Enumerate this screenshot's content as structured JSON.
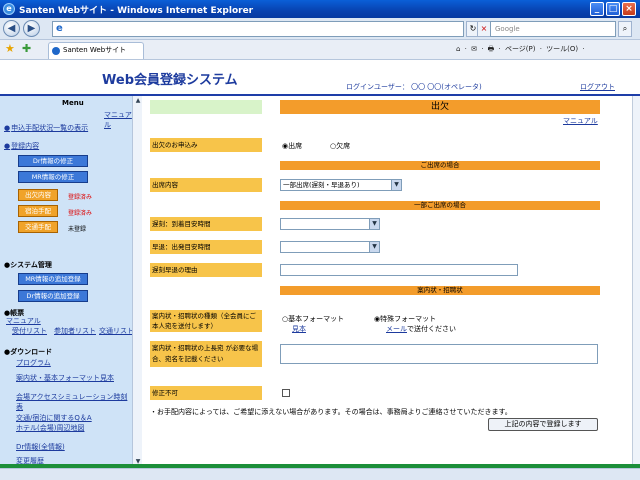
{
  "browser": {
    "window_title": "Santen Webサイト - Windows Internet Explorer",
    "back_label": "◀",
    "forward_label": "▶",
    "url_icon": "e",
    "search_placeholder": "Google",
    "tab_label": "Santen Webサイト",
    "tools_text": "⌂ · ✉ · 🖶 · ページ(P) · ツール(O) ·",
    "win_min": "_",
    "win_max": "□",
    "win_close": "×"
  },
  "header": {
    "system_title": "Web会員登録システム",
    "login_user": "ログインユーザー： 〇〇 〇〇(オペレータ)",
    "logout": "ログアウト"
  },
  "sidebar": {
    "menu_title": "Menu",
    "manual": "マニュアル",
    "application_list": "申込手配状況一覧の表示",
    "registration_head": "登録内容",
    "btn_dr_fix": "Dr情報の修正",
    "btn_mr_fix": "MR情報の修正",
    "btn_attendance": "出欠内容",
    "btn_lodging": "宿泊手配",
    "btn_transport": "交通手配",
    "status_attendance": "登録済み",
    "status_lodging": "登録済み",
    "status_transport": "未登録",
    "system_mgmt_head": "システム管理",
    "btn_mr_add": "MR情報の追加登録",
    "btn_dr_add": "Dr情報の追加登録",
    "docs_head": "帳票",
    "docs_manual": "マニュアル",
    "list_reception": "受付リスト",
    "list_participants": "参加者リスト",
    "list_transport": "交通リスト",
    "download_head": "ダウンロード",
    "dl_program": "プログラム",
    "dl_format": "案内状・基本フォーマット見本",
    "dl_access": "会場アクセスシミュレーション時刻表",
    "dl_qa": "交通/宿泊に関するQ＆A",
    "dl_map": "ホテル(会場)周辺地図",
    "dr_info": "Dr情報(全情報)",
    "history": "変更履歴"
  },
  "main": {
    "heading": "出欠",
    "manual": "マニュアル",
    "label_attendance": "出欠のお申込み",
    "radio_attend": "出席",
    "radio_absent": "欠席",
    "section_attend": "ご出席の場合",
    "label_detail": "出席内容",
    "select_detail_value": "一部出席(遅刻・早退あり)",
    "section_partial": "一部ご出席の場合",
    "label_late_time": "遅刻：到着目安時間",
    "label_early_time": "早退：出発目安時間",
    "label_reason": "遅刻早退の理由",
    "section_document": "案内状・招聘状",
    "label_doc_type": "案内状・招聘状の種類（全会員にご本人宛を送付します）",
    "radio_basic": "基本フォーマット",
    "radio_basic_sample": "見本",
    "radio_special": "特殊フォーマット",
    "special_mail_link": "メール",
    "special_mail_text": "で送付ください",
    "label_doc_note": "案内状・招聘状の上長宛 が必要な場合、宛名を記載ください",
    "label_edit_ok": "修正不可",
    "note": "・お手配内容によっては、ご希望に添えない場合があります。その場合は、事務局よりご連絡させていただきます。",
    "submit": "上記の内容で登録します"
  }
}
